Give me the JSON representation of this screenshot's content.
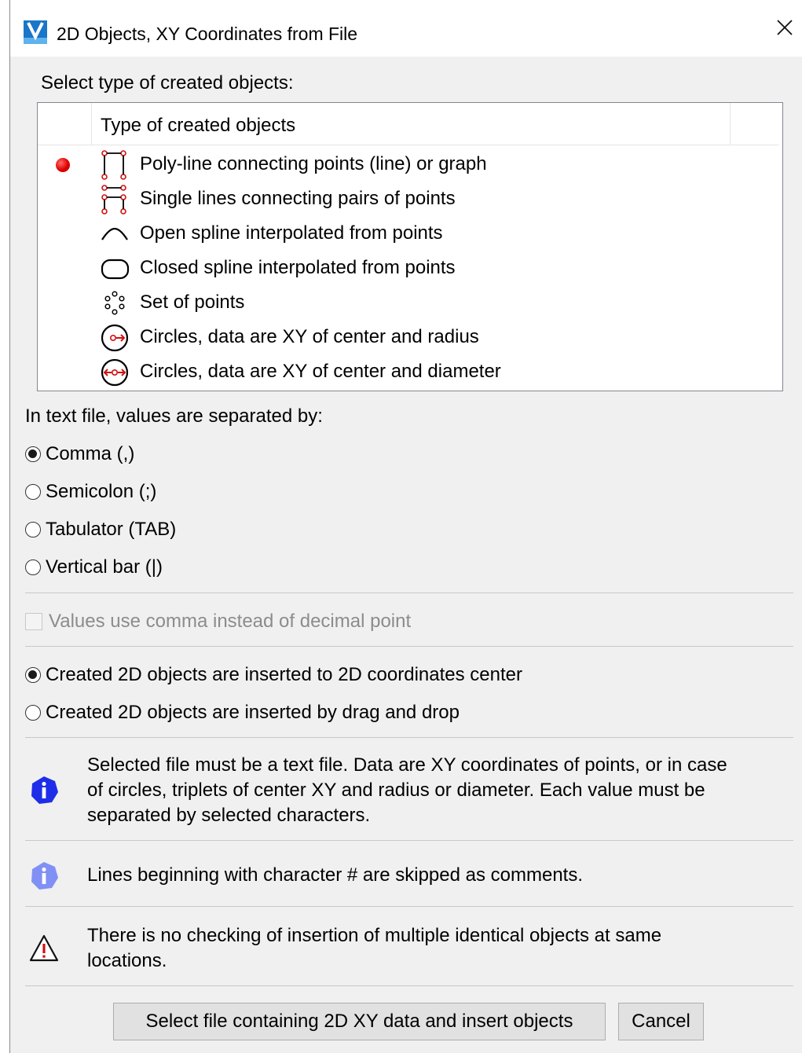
{
  "window": {
    "title": "2D Objects, XY Coordinates from File",
    "close_glyph": "✕"
  },
  "object_type": {
    "prompt": "Select type of created objects:",
    "column_header": "Type of created objects",
    "selected_index": 0,
    "items": [
      {
        "label": "Poly-line connecting points (line) or graph",
        "icon": "polyline-icon"
      },
      {
        "label": "Single lines connecting pairs of points",
        "icon": "single-lines-icon"
      },
      {
        "label": "Open spline interpolated from points",
        "icon": "open-spline-icon"
      },
      {
        "label": "Closed spline interpolated from points",
        "icon": "closed-spline-icon"
      },
      {
        "label": "Set of points",
        "icon": "point-set-icon"
      },
      {
        "label": "Circles, data are XY of center and radius",
        "icon": "circle-radius-icon"
      },
      {
        "label": "Circles, data are XY of center and diameter",
        "icon": "circle-diameter-icon"
      }
    ]
  },
  "separator": {
    "prompt": "In text file, values are separated by:",
    "options": [
      {
        "label": "Comma (,)",
        "checked": true
      },
      {
        "label": "Semicolon (;)",
        "checked": false
      },
      {
        "label": "Tabulator (TAB)",
        "checked": false
      },
      {
        "label": "Vertical bar (|)",
        "checked": false
      }
    ]
  },
  "decimal_comma": {
    "label": "Values use comma instead of decimal point",
    "checked": false,
    "enabled": false
  },
  "insertion": {
    "options": [
      {
        "label": "Created 2D objects are inserted to 2D coordinates center",
        "checked": true
      },
      {
        "label": "Created 2D objects are inserted by drag and drop",
        "checked": false
      }
    ]
  },
  "notes": {
    "info1_lines": [
      "Selected file must be a text file. Data are XY coordinates of points, or in case",
      "of circles, triplets of center XY and radius or diameter. Each value must be",
      "separated by selected characters."
    ],
    "info2": "Lines beginning with character # are skipped as comments.",
    "warning_lines": [
      "There is no checking of insertion of multiple identical objects at same",
      "locations."
    ]
  },
  "buttons": {
    "select_file": "Select file containing 2D XY data and insert objects",
    "cancel": "Cancel"
  },
  "colors": {
    "accent_red": "#e00000",
    "info_blue": "#1e2ee8",
    "info_light_blue": "#8090f5"
  }
}
